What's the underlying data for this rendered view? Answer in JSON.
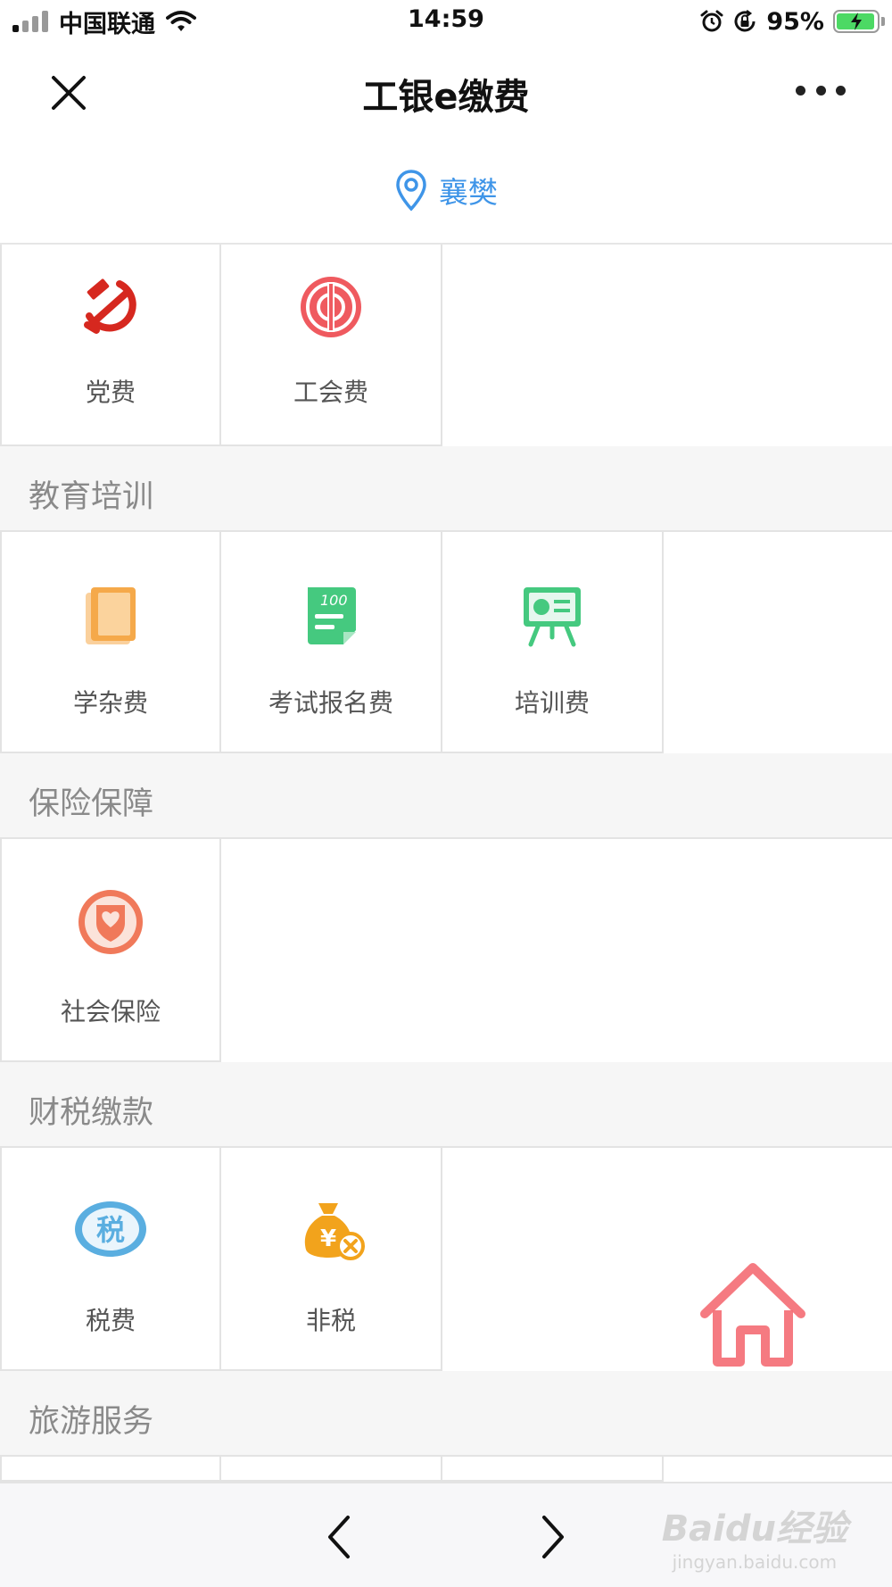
{
  "status_bar": {
    "carrier": "中国联通",
    "time": "14:59",
    "battery": "95%"
  },
  "nav": {
    "title": "工银e缴费"
  },
  "location": {
    "city": "襄樊"
  },
  "sections": {
    "party": {
      "items": [
        {
          "label": "党费",
          "icon": "hammer-sickle-icon"
        },
        {
          "label": "工会费",
          "icon": "trade-union-icon"
        }
      ]
    },
    "education": {
      "title": "教育培训",
      "items": [
        {
          "label": "学杂费",
          "icon": "book-icon"
        },
        {
          "label": "考试报名费",
          "icon": "exam-paper-icon"
        },
        {
          "label": "培训费",
          "icon": "presentation-board-icon"
        }
      ]
    },
    "insurance": {
      "title": "保险保障",
      "items": [
        {
          "label": "社会保险",
          "icon": "shield-icon"
        }
      ]
    },
    "tax": {
      "title": "财税缴款",
      "items": [
        {
          "label": "税费",
          "icon": "tax-icon"
        },
        {
          "label": "非税",
          "icon": "money-bag-icon"
        }
      ]
    },
    "travel": {
      "title": "旅游服务"
    }
  },
  "tax_icon_text": "税",
  "watermark": {
    "logo": "Baidu经验",
    "url": "jingyan.baidu.com"
  },
  "colors": {
    "accent_blue": "#3f95e8",
    "party_red": "#d6281f",
    "union_red": "#ef5a5f",
    "edu_orange": "#f5a94a",
    "edu_green": "#45c97f",
    "insurance_orange": "#f0795a",
    "tax_blue": "#5aaee0",
    "nontax_orange": "#f2a31c",
    "home_pink": "#f46b73"
  }
}
